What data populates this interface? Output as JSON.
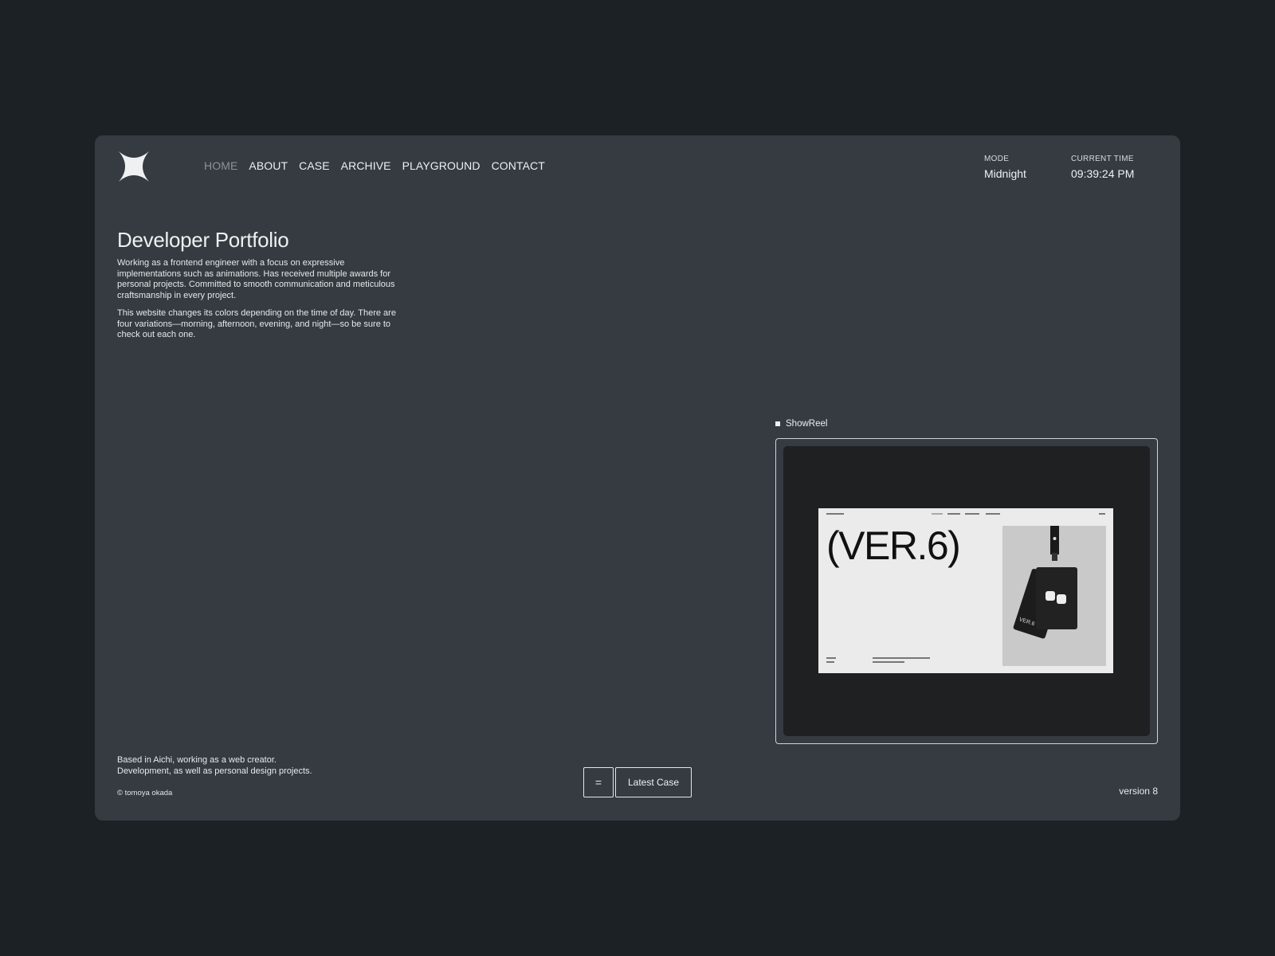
{
  "nav": {
    "items": [
      {
        "label": "HOME",
        "active": true
      },
      {
        "label": "ABOUT",
        "active": false
      },
      {
        "label": "CASE",
        "active": false
      },
      {
        "label": "ARCHIVE",
        "active": false
      },
      {
        "label": "PLAYGROUND",
        "active": false
      },
      {
        "label": "CONTACT",
        "active": false
      }
    ]
  },
  "status": {
    "mode_label": "MODE",
    "mode_value": "Midnight",
    "time_label": "CURRENT TIME",
    "time_value": "09:39:24 PM"
  },
  "hero": {
    "title": "Developer Portfolio",
    "paragraph1": "Working as a frontend engineer with a focus on expressive implementations such as animations. Has received multiple awards for personal projects. Committed to smooth communication and meticulous craftsmanship in every project.",
    "paragraph2": "This website changes its colors depending on the time of day. There are four variations—morning, afternoon, evening, and night—so be sure to check out each one."
  },
  "showreel": {
    "label": "ShowReel",
    "thumb_text": "(VER.6)"
  },
  "footer": {
    "bio_line1": "Based in Aichi, working as a web creator.",
    "bio_line2": "Development, as well as personal design projects.",
    "copyright": "© tomoya okada",
    "menu_glyph": "=",
    "latest_label": "Latest Case",
    "version": "version 8"
  },
  "colors": {
    "page_bg": "#1b2124",
    "card_bg": "#353b41",
    "text": "#eef0f1",
    "nav_active": "#8d9398",
    "reel_bg": "#1f2022"
  },
  "icons": {
    "logo": "four-point-star-icon",
    "bullet": "square-bullet-icon",
    "menu": "menu-icon"
  }
}
